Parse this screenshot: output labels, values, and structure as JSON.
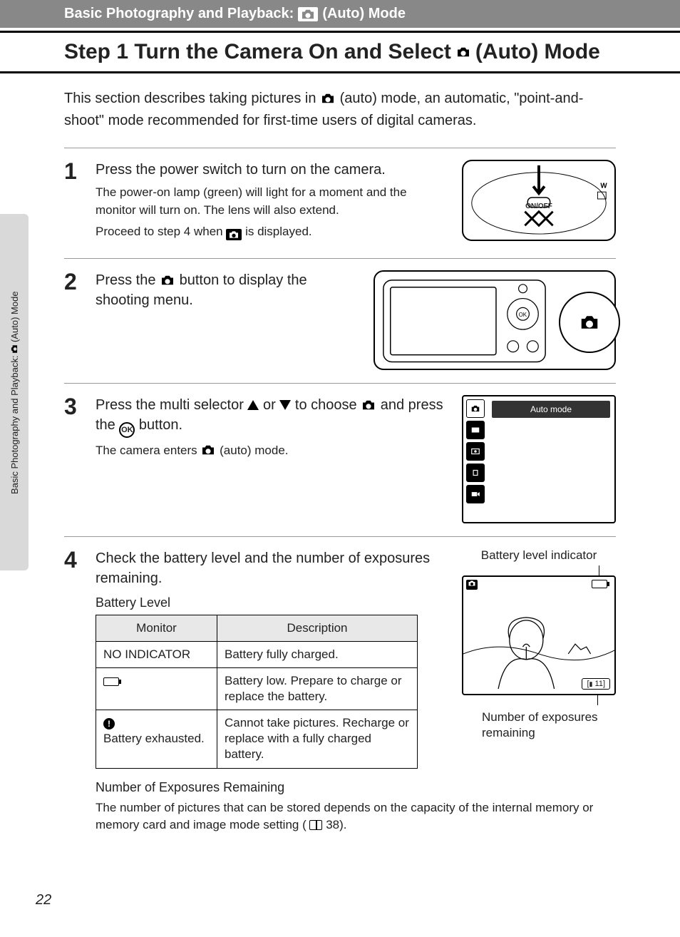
{
  "header": {
    "prefix": "Basic Photography and Playback:",
    "suffix": "(Auto) Mode"
  },
  "title": {
    "prefix": "Step 1 Turn the Camera On and Select",
    "suffix": "(Auto) Mode"
  },
  "intro": {
    "p1a": "This section describes taking pictures in ",
    "p1b": " (auto) mode, an automatic, \"point-and-shoot\" mode recommended for first-time users of digital cameras."
  },
  "side_tab": {
    "prefix": "Basic Photography and Playback:",
    "suffix": "(Auto) Mode"
  },
  "steps": {
    "s1": {
      "num": "1",
      "head": "Press the power switch to turn on the camera.",
      "sub1": "The power-on lamp (green) will light for a moment and the monitor will turn on. The lens will also extend.",
      "sub2a": "Proceed to step 4 when ",
      "sub2b": " is displayed.",
      "onoff": "ON/OFF"
    },
    "s2": {
      "num": "2",
      "head_a": "Press the ",
      "head_b": " button to display the shooting menu."
    },
    "s3": {
      "num": "3",
      "head_a": "Press the multi selector ",
      "head_b": " or ",
      "head_c": " to choose ",
      "head_d": " and press the ",
      "head_e": " button.",
      "sub_a": "The camera enters ",
      "sub_b": " (auto) mode.",
      "ok": "OK",
      "mode_label": "Auto mode"
    },
    "s4": {
      "num": "4",
      "head": "Check the battery level and the number of exposures remaining.",
      "bat_heading": "Battery Level",
      "label_top": "Battery level indicator",
      "label_bot": "Number of exposures remaining",
      "remaining_count": "11",
      "table": {
        "h1": "Monitor",
        "h2": "Description",
        "r1c1": "NO INDICATOR",
        "r1c2": "Battery fully charged.",
        "r2c2": "Battery low. Prepare to charge or replace the battery.",
        "r3c1": "Battery exhausted.",
        "r3c2": "Cannot take pictures. Recharge or replace with a fully charged battery."
      },
      "exp_heading": "Number of Exposures Remaining",
      "exp_body_a": "The number of pictures that can be stored depends on the capacity of the internal memory or memory card and image mode setting (",
      "exp_body_b": " 38)."
    }
  },
  "page_number": "22"
}
